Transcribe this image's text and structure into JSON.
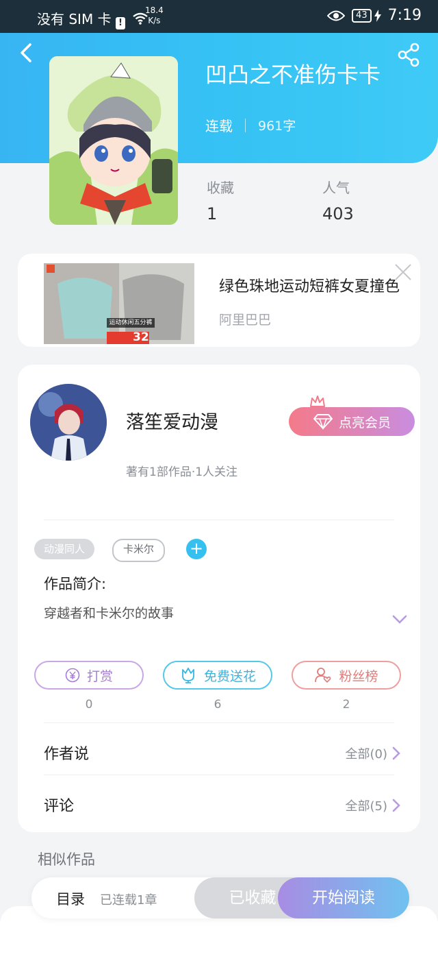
{
  "status_bar": {
    "carrier": "没有 SIM 卡",
    "speed_value": "18.4",
    "speed_unit": "K/s",
    "battery": "43",
    "time": "7:19"
  },
  "book": {
    "title": "凹凸之不准伤卡卡",
    "status": "连载",
    "word_count": "961字",
    "favorites_label": "收藏",
    "favorites_value": "1",
    "popularity_label": "人气",
    "popularity_value": "403"
  },
  "ad": {
    "title": "绿色珠地运动短裤女夏撞色",
    "source": "阿里巴巴",
    "image_caption": "运动休闲五分裤",
    "price": "32"
  },
  "author": {
    "name": "落笙爱动漫",
    "meta": "著有1部作品·1人关注",
    "vip_button": "点亮会员"
  },
  "tags": [
    "动漫同人",
    "卡米尔"
  ],
  "tag_add": "+",
  "intro": {
    "label": "作品简介:",
    "text": "穿越者和卡米尔的故事"
  },
  "actions": {
    "reward": {
      "label": "打赏",
      "count": "0"
    },
    "flower": {
      "label": "免费送花",
      "count": "6"
    },
    "fans": {
      "label": "粉丝榜",
      "count": "2"
    }
  },
  "author_says": {
    "label": "作者说",
    "link": "全部(0)"
  },
  "comments": {
    "label": "评论",
    "link": "全部(5)"
  },
  "similar_label": "相似作品",
  "bottom": {
    "toc": "目录",
    "chapters": "已连载1章",
    "collected": "已收藏",
    "start_reading": "开始阅读"
  },
  "colors": {
    "header": "#37b5f3",
    "accent": "#36c0f0",
    "vip_start": "#f47a89",
    "vip_end": "#c98de0"
  }
}
